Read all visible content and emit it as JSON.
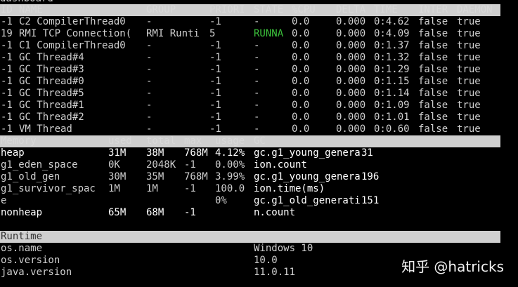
{
  "app": {
    "title": "dashboard"
  },
  "threads": {
    "headers": [
      "ID",
      "NAME",
      "GROUP",
      "PRIORI",
      "STATE",
      "%CPU",
      "DELTA",
      "TIME",
      "INTER",
      "DAEMON"
    ],
    "rows": [
      [
        "-1",
        "C2 CompilerThread0",
        "-",
        "-1",
        "-",
        "0.0",
        "0.000",
        "0:4.62",
        "false",
        "true"
      ],
      [
        "19",
        "RMI TCP Connection(",
        "RMI Runti",
        "5",
        "RUNNA",
        "0.0",
        "0.000",
        "0:4.09",
        "false",
        "true"
      ],
      [
        "-1",
        "C1 CompilerThread0",
        "-",
        "-1",
        "-",
        "0.0",
        "0.000",
        "0:1.37",
        "false",
        "true"
      ],
      [
        "-1",
        "GC Thread#4",
        "-",
        "-1",
        "-",
        "0.0",
        "0.000",
        "0:1.32",
        "false",
        "true"
      ],
      [
        "-1",
        "GC Thread#3",
        "-",
        "-1",
        "-",
        "0.0",
        "0.000",
        "0:1.29",
        "false",
        "true"
      ],
      [
        "-1",
        "GC Thread#0",
        "-",
        "-1",
        "-",
        "0.0",
        "0.000",
        "0:1.15",
        "false",
        "true"
      ],
      [
        "-1",
        "GC Thread#5",
        "-",
        "-1",
        "-",
        "0.0",
        "0.000",
        "0:1.14",
        "false",
        "true"
      ],
      [
        "-1",
        "GC Thread#1",
        "-",
        "-1",
        "-",
        "0.0",
        "0.000",
        "0:1.09",
        "false",
        "true"
      ],
      [
        "-1",
        "GC Thread#2",
        "-",
        "-1",
        "-",
        "0.0",
        "0.000",
        "0:1.01",
        "false",
        "true"
      ],
      [
        "-1",
        "VM Thread",
        "-",
        "-1",
        "-",
        "0.0",
        "0.000",
        "0:0.60",
        "false",
        "true"
      ]
    ],
    "running_color": "#3cc23c"
  },
  "memory": {
    "headers": [
      "Memory",
      "used",
      "total",
      "max",
      "usage",
      "GC"
    ],
    "rows": [
      [
        "heap",
        "31M",
        "38M",
        "768M",
        "4.12%",
        "gc.g1_young_generat",
        "31"
      ],
      [
        "g1_eden_space",
        "0K",
        "2048K",
        "-1",
        "0.00%",
        "ion.count",
        ""
      ],
      [
        "g1_old_gen",
        "30M",
        "35M",
        "768M",
        "3.99%",
        "gc.g1_young_generat",
        "196"
      ],
      [
        "g1_survivor_spac",
        "1M",
        "1M",
        "-1",
        "100.0",
        "ion.time(ms)",
        ""
      ],
      [
        "e",
        "",
        "",
        "",
        "0%",
        "gc.g1_old_generatio",
        "151"
      ],
      [
        "nonheap",
        "65M",
        "68M",
        "-1",
        "",
        "n.count",
        ""
      ]
    ]
  },
  "runtime": {
    "header": "Runtime",
    "rows": [
      [
        "os.name",
        "Windows 10"
      ],
      [
        "os.version",
        "10.0"
      ],
      [
        "java.version",
        "11.0.11"
      ]
    ]
  },
  "watermark": "知乎 @hatricks",
  "colors": {
    "header_bg": "#cfcfcf",
    "background": "#000000",
    "text": "#d8d8d8"
  }
}
